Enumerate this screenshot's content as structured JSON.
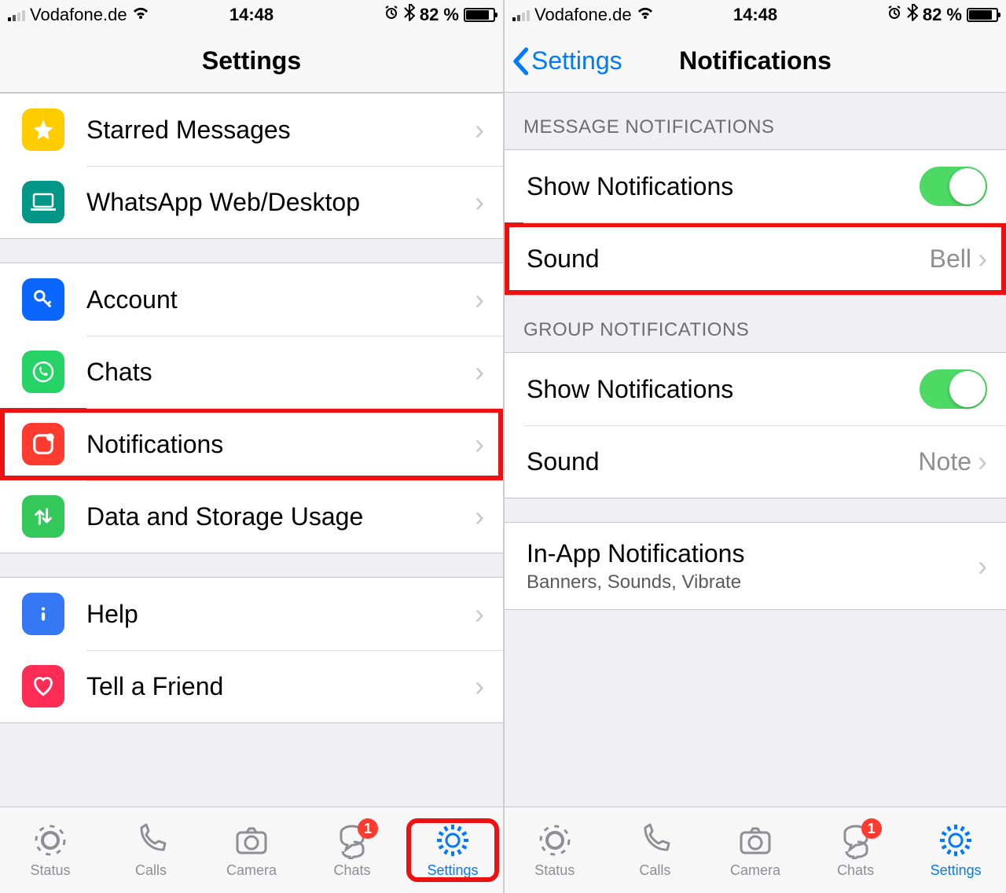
{
  "status_bar": {
    "carrier": "Vodafone.de",
    "time": "14:48",
    "battery_pct": "82 %"
  },
  "left": {
    "nav_title": "Settings",
    "rows_g1": [
      {
        "label": "Starred Messages",
        "name": "row-starred-messages",
        "icon": "star",
        "color": "bg-yellow"
      },
      {
        "label": "WhatsApp Web/Desktop",
        "name": "row-whatsapp-web",
        "icon": "laptop",
        "color": "bg-teal"
      }
    ],
    "rows_g2": [
      {
        "label": "Account",
        "name": "row-account",
        "icon": "key",
        "color": "bg-blue"
      },
      {
        "label": "Chats",
        "name": "row-chats",
        "icon": "whatsapp",
        "color": "bg-green",
        "highlight": false
      },
      {
        "label": "Notifications",
        "name": "row-notifications",
        "icon": "notif",
        "color": "bg-red",
        "highlight": true
      },
      {
        "label": "Data and Storage Usage",
        "name": "row-data-storage",
        "icon": "updown",
        "color": "bg-green2"
      }
    ],
    "rows_g3": [
      {
        "label": "Help",
        "name": "row-help",
        "icon": "info",
        "color": "bg-bluei"
      },
      {
        "label": "Tell a Friend",
        "name": "row-tell-friend",
        "icon": "heart",
        "color": "bg-pink"
      }
    ]
  },
  "right": {
    "back_label": "Settings",
    "nav_title": "Notifications",
    "section1": "MESSAGE NOTIFICATIONS",
    "sec1_rows": {
      "show": "Show Notifications",
      "sound_label": "Sound",
      "sound_value": "Bell"
    },
    "section2": "GROUP NOTIFICATIONS",
    "sec2_rows": {
      "show": "Show Notifications",
      "sound_label": "Sound",
      "sound_value": "Note"
    },
    "inapp": {
      "label": "In-App Notifications",
      "sub": "Banners, Sounds, Vibrate"
    }
  },
  "tabs": [
    {
      "label": "Status",
      "name": "tab-status",
      "icon": "status"
    },
    {
      "label": "Calls",
      "name": "tab-calls",
      "icon": "phone"
    },
    {
      "label": "Camera",
      "name": "tab-camera",
      "icon": "camera"
    },
    {
      "label": "Chats",
      "name": "tab-chats",
      "icon": "chat",
      "badge": "1"
    },
    {
      "label": "Settings",
      "name": "tab-settings",
      "icon": "gear",
      "active": true
    }
  ]
}
